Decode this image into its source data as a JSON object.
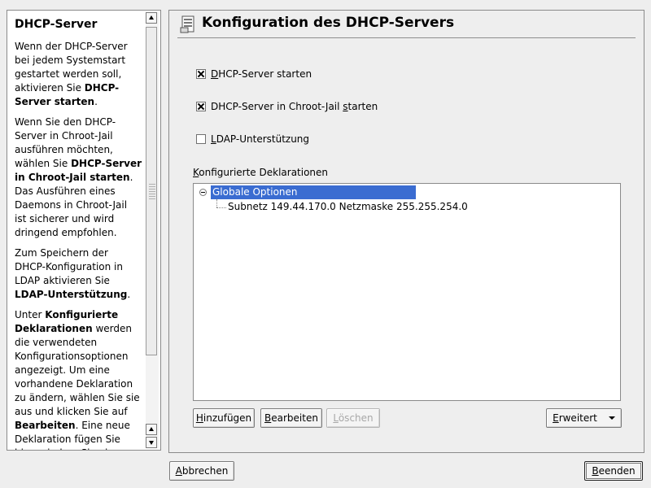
{
  "help": {
    "title": "DHCP-Server",
    "p1_text": "Wenn der DHCP-Server bei jedem Systemstart gestartet werden soll, aktivieren Sie ",
    "p1_bold": "DHCP-Server starten",
    "p1_end": ".",
    "p2_text": "Wenn Sie den DHCP-Server in Chroot-Jail ausführen möchten, wählen Sie ",
    "p2_bold": "DHCP-Server in Chroot-Jail starten",
    "p2_end": ". Das Ausführen eines Daemons in Chroot-Jail ist sicherer und wird dringend empfohlen.",
    "p3_text": "Zum Speichern der DHCP-Konfiguration in LDAP aktivieren Sie ",
    "p3_bold": "LDAP-Unterstützung",
    "p3_end": ".",
    "p4_pre": "Unter ",
    "p4_bold1": "Konfigurierte Deklarationen",
    "p4_mid": " werden die verwendeten Konfigurationsoptionen angezeigt. Um eine vorhandene Deklaration zu ändern, wählen Sie sie aus und klicken Sie auf ",
    "p4_bold2": "Bearbeiten",
    "p4_end": ". Eine neue Deklaration fügen Sie hinzu, indem Sie eine Deklaration auswählen, in der die neue Deklaration"
  },
  "dialog": {
    "title": "Konfiguration des DHCP-Servers"
  },
  "options": {
    "start_accel": "D",
    "start_rest": "HCP-Server starten",
    "start_checked": true,
    "chroot_pre": "DHCP-Server in Chroot-Jail ",
    "chroot_accel": "s",
    "chroot_rest": "tarten",
    "chroot_checked": true,
    "ldap_accel": "L",
    "ldap_rest": "DAP-Unterstützung",
    "ldap_checked": false
  },
  "declarations": {
    "label_accel": "K",
    "label_rest": "onfigurierte Deklarationen",
    "root": "Globale Optionen",
    "child": "Subnetz 149.44.170.0 Netzmaske 255.255.254.0"
  },
  "buttons": {
    "add_accel": "H",
    "add_rest": "inzufügen",
    "edit_accel": "B",
    "edit_rest": "earbeiten",
    "delete_accel": "L",
    "delete_rest": "öschen",
    "advanced_accel": "E",
    "advanced_rest": "rweitert",
    "cancel_accel": "A",
    "cancel_rest": "bbrechen",
    "finish_accel": "B",
    "finish_rest": "eenden"
  }
}
